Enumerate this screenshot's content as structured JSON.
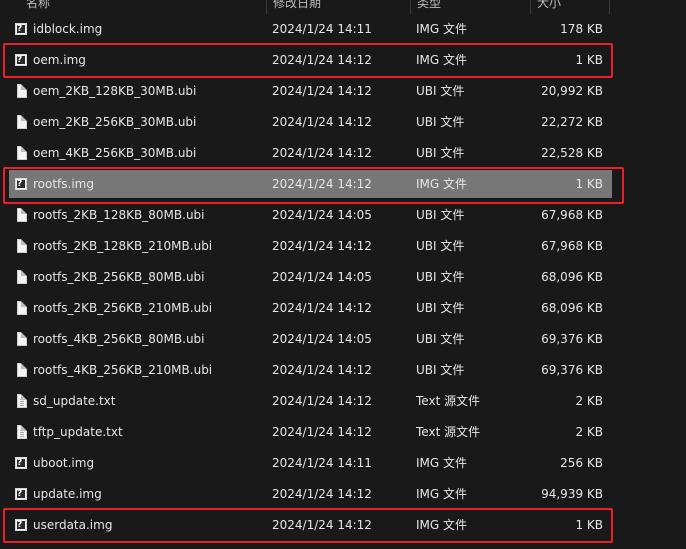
{
  "columns": {
    "name": "名称",
    "date": "修改日期",
    "type": "类型",
    "size": "大小"
  },
  "files": [
    {
      "name": "idblock.img",
      "date": "2024/1/24 14:11",
      "type": "IMG 文件",
      "size": "178 KB",
      "icon": "img-file-icon"
    },
    {
      "name": "oem.img",
      "date": "2024/1/24 14:12",
      "type": "IMG 文件",
      "size": "1 KB",
      "icon": "img-file-icon"
    },
    {
      "name": "oem_2KB_128KB_30MB.ubi",
      "date": "2024/1/24 14:12",
      "type": "UBI 文件",
      "size": "20,992 KB",
      "icon": "generic-file-icon"
    },
    {
      "name": "oem_2KB_256KB_30MB.ubi",
      "date": "2024/1/24 14:12",
      "type": "UBI 文件",
      "size": "22,272 KB",
      "icon": "generic-file-icon"
    },
    {
      "name": "oem_4KB_256KB_30MB.ubi",
      "date": "2024/1/24 14:12",
      "type": "UBI 文件",
      "size": "22,528 KB",
      "icon": "generic-file-icon"
    },
    {
      "name": "rootfs.img",
      "date": "2024/1/24 14:12",
      "type": "IMG 文件",
      "size": "1 KB",
      "icon": "img-file-icon"
    },
    {
      "name": "rootfs_2KB_128KB_80MB.ubi",
      "date": "2024/1/24 14:05",
      "type": "UBI 文件",
      "size": "67,968 KB",
      "icon": "generic-file-icon"
    },
    {
      "name": "rootfs_2KB_128KB_210MB.ubi",
      "date": "2024/1/24 14:12",
      "type": "UBI 文件",
      "size": "67,968 KB",
      "icon": "generic-file-icon"
    },
    {
      "name": "rootfs_2KB_256KB_80MB.ubi",
      "date": "2024/1/24 14:05",
      "type": "UBI 文件",
      "size": "68,096 KB",
      "icon": "generic-file-icon"
    },
    {
      "name": "rootfs_2KB_256KB_210MB.ubi",
      "date": "2024/1/24 14:12",
      "type": "UBI 文件",
      "size": "68,096 KB",
      "icon": "generic-file-icon"
    },
    {
      "name": "rootfs_4KB_256KB_80MB.ubi",
      "date": "2024/1/24 14:05",
      "type": "UBI 文件",
      "size": "69,376 KB",
      "icon": "generic-file-icon"
    },
    {
      "name": "rootfs_4KB_256KB_210MB.ubi",
      "date": "2024/1/24 14:12",
      "type": "UBI 文件",
      "size": "69,376 KB",
      "icon": "generic-file-icon"
    },
    {
      "name": "sd_update.txt",
      "date": "2024/1/24 14:12",
      "type": "Text 源文件",
      "size": "2 KB",
      "icon": "text-file-icon"
    },
    {
      "name": "tftp_update.txt",
      "date": "2024/1/24 14:12",
      "type": "Text 源文件",
      "size": "2 KB",
      "icon": "text-file-icon"
    },
    {
      "name": "uboot.img",
      "date": "2024/1/24 14:11",
      "type": "IMG 文件",
      "size": "256 KB",
      "icon": "img-file-icon"
    },
    {
      "name": "update.img",
      "date": "2024/1/24 14:12",
      "type": "IMG 文件",
      "size": "94,939 KB",
      "icon": "img-file-icon"
    },
    {
      "name": "userdata.img",
      "date": "2024/1/24 14:12",
      "type": "IMG 文件",
      "size": "1 KB",
      "icon": "img-file-icon"
    }
  ],
  "selected_index": 5,
  "highlighted_indices": [
    1,
    5,
    16
  ],
  "colors": {
    "background": "#191919",
    "selected_row": "#777777",
    "highlight_box": "#e8202a",
    "text": "#e6e6e6"
  }
}
